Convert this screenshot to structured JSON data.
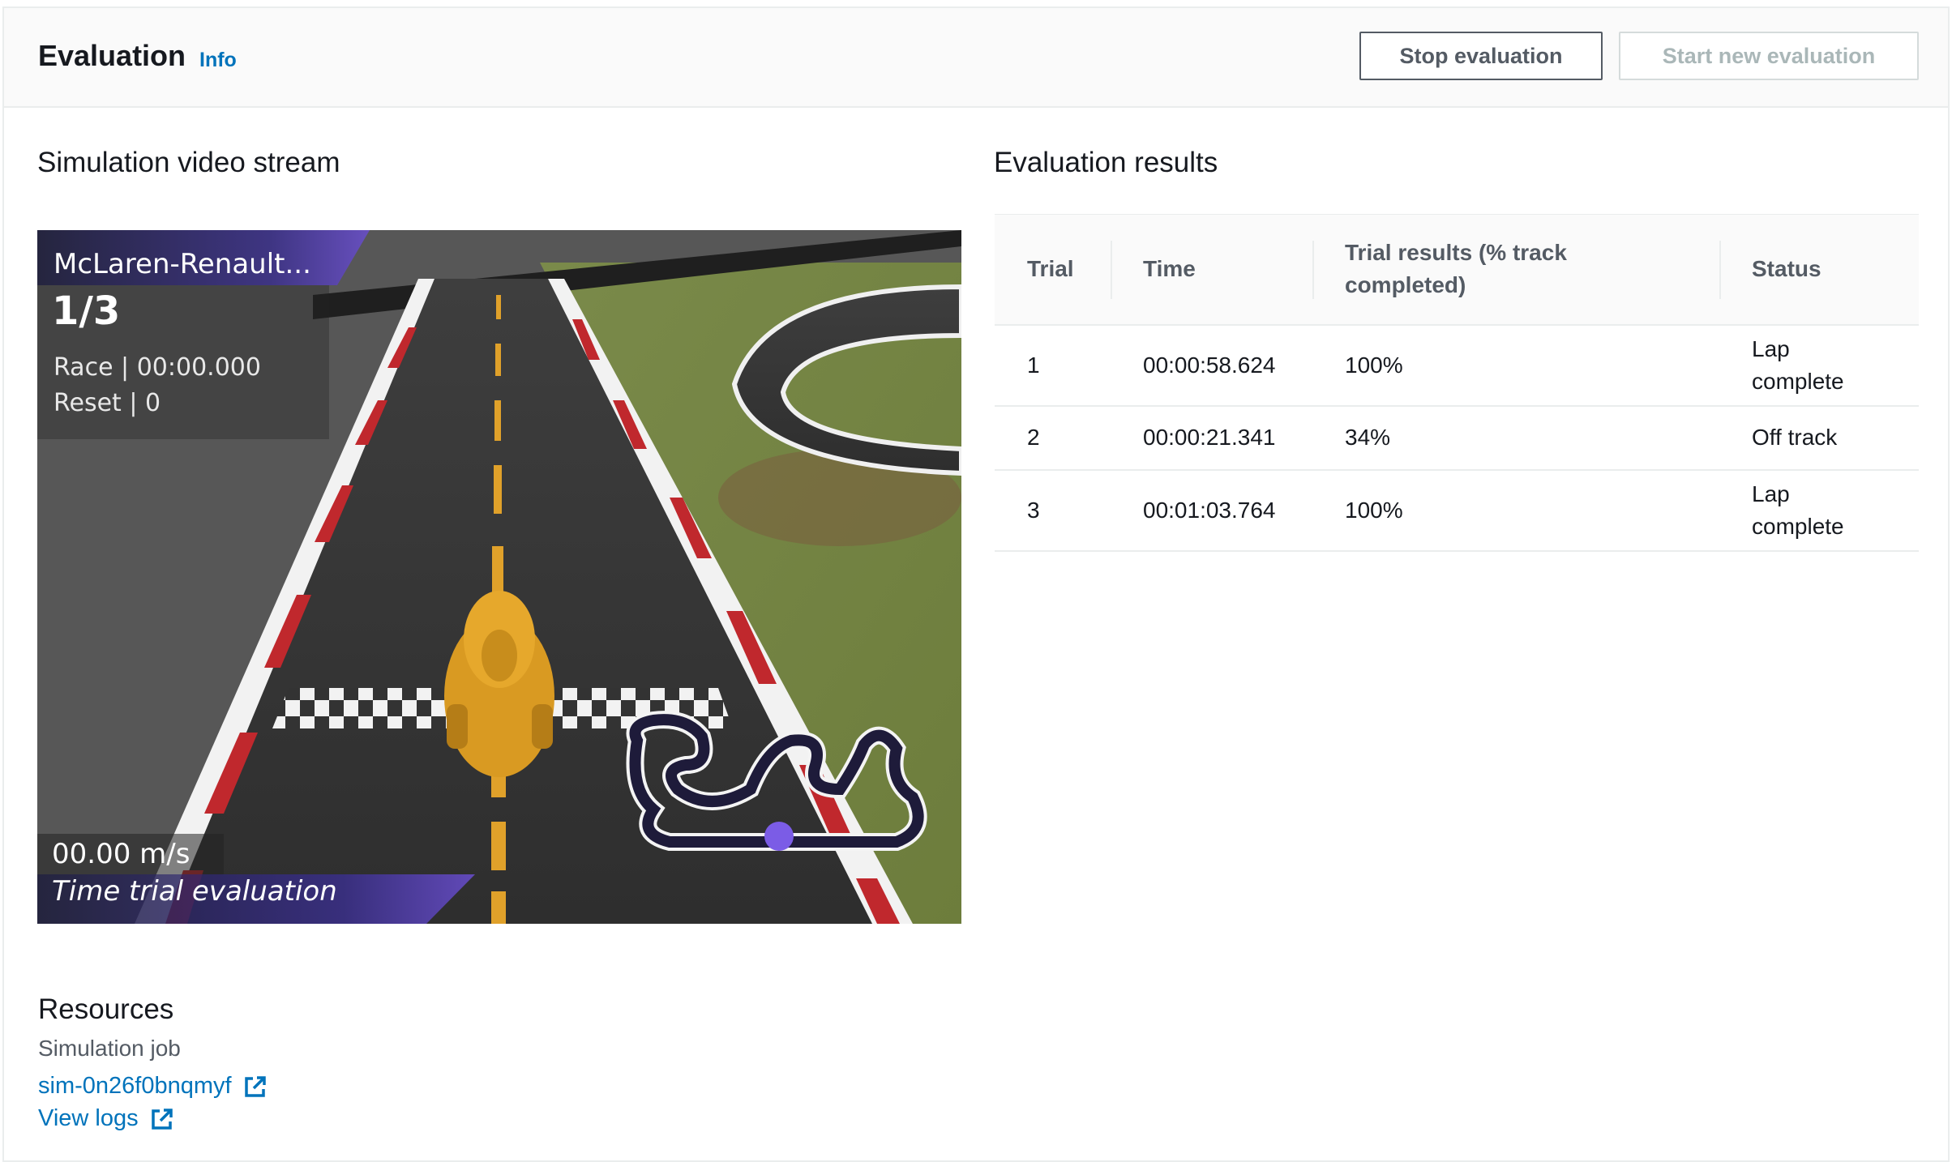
{
  "header": {
    "title": "Evaluation",
    "info_label": "Info",
    "stop_button": "Stop evaluation",
    "start_button": "Start new evaluation"
  },
  "video": {
    "section_title": "Simulation video stream",
    "overlay": {
      "car_name": "McLaren-Renault...",
      "lap": "1/3",
      "race": "Race | 00:00.000",
      "reset": "Reset | 0",
      "speed": "00.00 m/s",
      "mode": "Time trial evaluation"
    }
  },
  "results": {
    "section_title": "Evaluation results",
    "columns": [
      "Trial",
      "Time",
      "Trial results (% track completed)",
      "Status"
    ],
    "rows": [
      {
        "trial": "1",
        "time": "00:00:58.624",
        "result": "100%",
        "status": "Lap complete"
      },
      {
        "trial": "2",
        "time": "00:00:21.341",
        "result": "34%",
        "status": "Off track"
      },
      {
        "trial": "3",
        "time": "00:01:03.764",
        "result": "100%",
        "status": "Lap complete"
      }
    ]
  },
  "resources": {
    "heading": "Resources",
    "label": "Simulation job",
    "sim_link": "sim-0n26f0bnqmyf",
    "logs_link": "View logs"
  },
  "colors": {
    "link": "#0073bb",
    "header_bg": "#fafafa",
    "overlay_purple": "#5a3bbf"
  }
}
